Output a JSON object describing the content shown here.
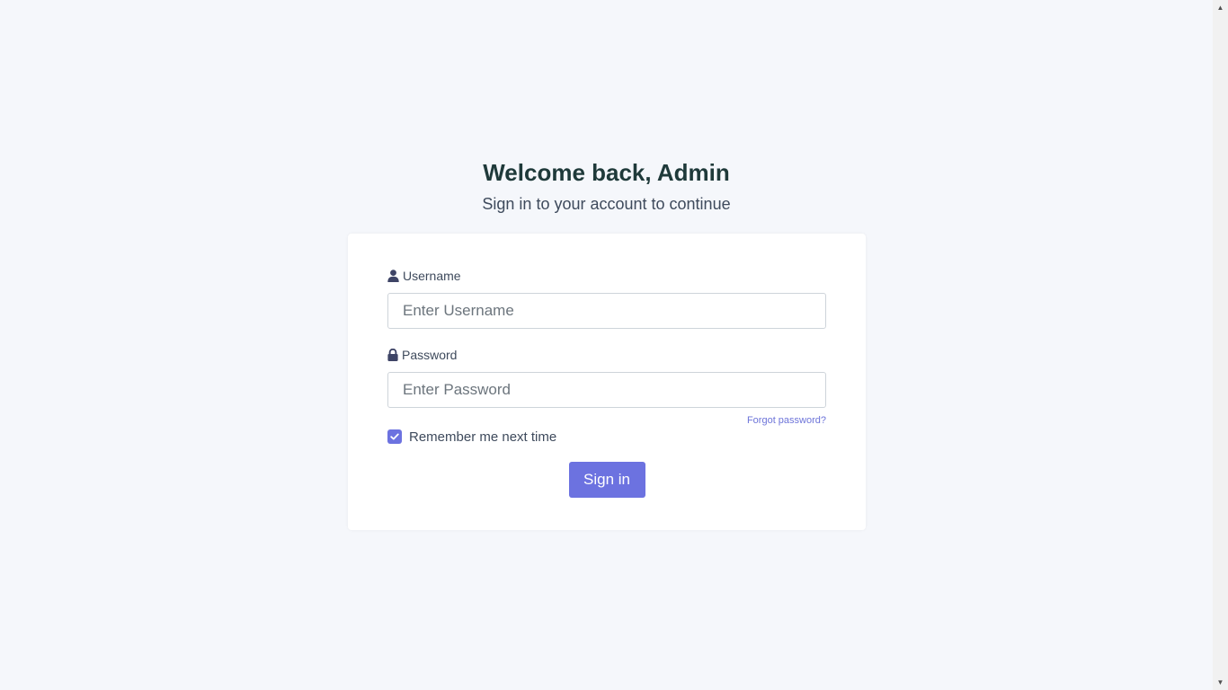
{
  "heading": {
    "title": "Welcome back, Admin",
    "subtitle": "Sign in to your account to continue"
  },
  "form": {
    "username": {
      "label": "Username",
      "icon": "user-icon",
      "placeholder": "Enter Username",
      "value": ""
    },
    "password": {
      "label": "Password",
      "icon": "lock-icon",
      "placeholder": "Enter Password",
      "value": ""
    },
    "forgot_password": "Forgot password?",
    "remember_me": {
      "label": "Remember me next time",
      "checked": true
    },
    "submit_label": "Sign in"
  },
  "colors": {
    "page_background": "#f5f7fb",
    "card_background": "#ffffff",
    "accent": "#6c72e0",
    "title": "#1f3a3a",
    "link": "#6d74d9"
  }
}
